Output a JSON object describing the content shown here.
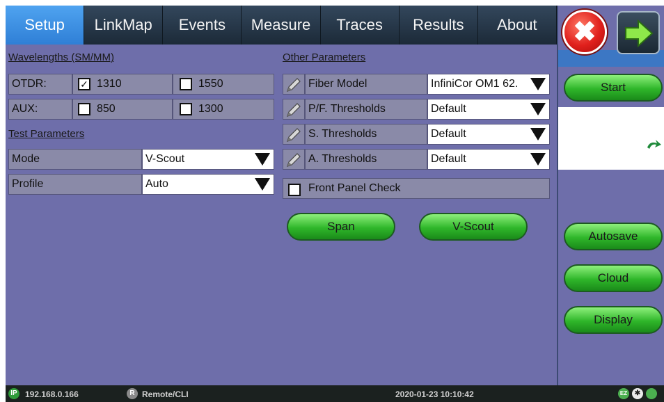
{
  "tabs": [
    {
      "label": "Setup",
      "active": true
    },
    {
      "label": "LinkMap"
    },
    {
      "label": "Events"
    },
    {
      "label": "Measure"
    },
    {
      "label": "Traces"
    },
    {
      "label": "Results"
    },
    {
      "label": "About"
    }
  ],
  "wavelengths": {
    "title": "Wavelengths (SM/MM)",
    "otdr_label": "OTDR:",
    "aux_label": "AUX:",
    "otdr_1310": {
      "label": "1310",
      "checked": true
    },
    "otdr_1550": {
      "label": "1550",
      "checked": false
    },
    "aux_850": {
      "label": "850",
      "checked": false
    },
    "aux_1300": {
      "label": "1300",
      "checked": false
    }
  },
  "test_parameters": {
    "title": "Test Parameters",
    "mode_label": "Mode",
    "mode_value": "V-Scout",
    "profile_label": "Profile",
    "profile_value": "Auto"
  },
  "other_parameters": {
    "title": "Other Parameters",
    "fiber_model_label": "Fiber Model",
    "fiber_model_value": "InfiniCor OM1 62.",
    "pf_thresholds_label": "P/F. Thresholds",
    "pf_thresholds_value": "Default",
    "s_thresholds_label": "S. Thresholds",
    "s_thresholds_value": "Default",
    "a_thresholds_label": "A. Thresholds",
    "a_thresholds_value": "Default",
    "front_panel_check_label": "Front Panel Check",
    "front_panel_checked": false
  },
  "buttons": {
    "span": "Span",
    "vscout": "V-Scout",
    "start": "Start",
    "autosave": "Autosave",
    "cloud": "Cloud",
    "display": "Display"
  },
  "status": {
    "ip_badge": "IP",
    "ip": "192.168.0.166",
    "remote_badge": "R",
    "remote": "Remote/CLI",
    "datetime": "2020-01-23  10:10:42",
    "ez_badge": "EZ"
  },
  "colors": {
    "background": "#6e6eaa",
    "active_tab": "#3a8fe6",
    "green_button": "#2fb62a",
    "close_red": "#e0201c"
  },
  "icons": {
    "check": "✓",
    "close": "✖",
    "pencil": "pencil-icon",
    "arrow": "arrow-right-icon",
    "refresh": "refresh-arrow-icon"
  }
}
